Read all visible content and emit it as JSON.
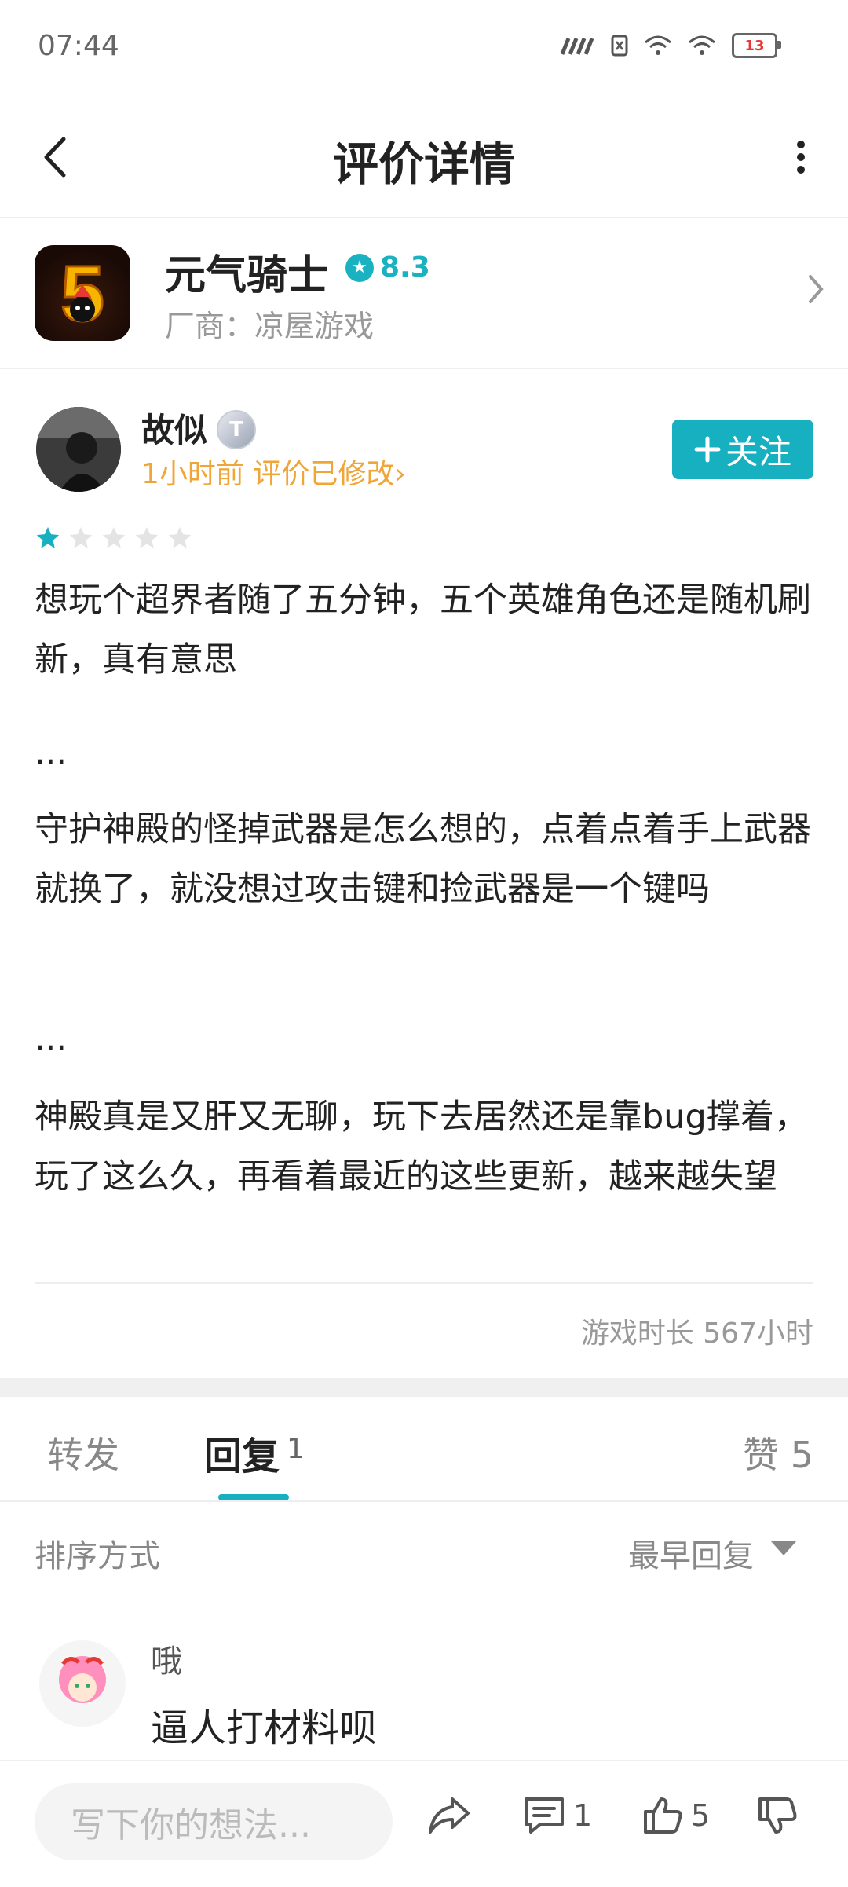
{
  "status_bar": {
    "time": "07:44",
    "battery": "13"
  },
  "header": {
    "title": "评价详情"
  },
  "game": {
    "name": "元气骑士",
    "rating": "8.3",
    "vendor": "厂商：凉屋游戏",
    "icon_text": "5"
  },
  "review": {
    "user": "故似",
    "level_badge": "T",
    "time_status": "1小时前 评价已修改›",
    "follow_label": "关注",
    "stars": 1,
    "paragraphs": [
      "想玩个超界者随了五分钟，五个英雄角色还是随机刷新，真有意思",
      "...",
      "守护神殿的怪掉武器是怎么想的，点着点着手上武器就换了，就没想过攻击键和捡武器是一个键吗",
      "...",
      "神殿真是又肝又无聊，玩下去居然还是靠bug撑着，玩了这么久，再看着最近的这些更新，越来越失望"
    ],
    "playtime": "游戏时长 567小时"
  },
  "tabs": {
    "forward": "转发",
    "reply": "回复",
    "reply_count": "1",
    "like": "赞 5"
  },
  "sort": {
    "label": "排序方式",
    "value": "最早回复"
  },
  "comment": {
    "user": "哦",
    "text": "逼人打材料呗"
  },
  "bottom_bar": {
    "input_placeholder": "写下你的想法...",
    "reply_count": "1",
    "like_count": "5"
  },
  "colors": {
    "accent": "#17b0c0",
    "time_orange": "#f0a537"
  }
}
